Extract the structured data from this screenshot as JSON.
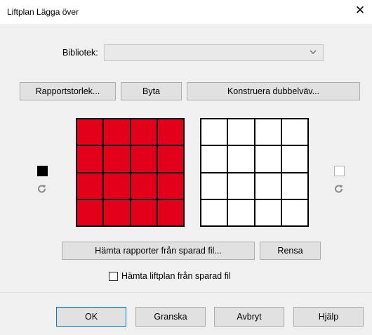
{
  "window": {
    "title": "Liftplan Lägga över",
    "close_glyph": "✕"
  },
  "library": {
    "label": "Bibliotek:",
    "value": ""
  },
  "toolbar": {
    "report_size": "Rapportstorlek...",
    "swap": "Byta",
    "construct_double": "Konstruera dubbelväv..."
  },
  "left_pattern": {
    "color": "#e2001a",
    "swatch_color": "#000000"
  },
  "right_pattern": {
    "color": "#ffffff",
    "swatch_color": "#ffffff"
  },
  "actions": {
    "fetch_reports": "Hämta rapporter från sparad fil...",
    "clear": "Rensa"
  },
  "options": {
    "fetch_liftplan_label": "Hämta liftplan från sparad fil",
    "fetch_liftplan_checked": false
  },
  "footer": {
    "ok": "OK",
    "review": "Granska",
    "cancel": "Avbryt",
    "help": "Hjälp"
  }
}
